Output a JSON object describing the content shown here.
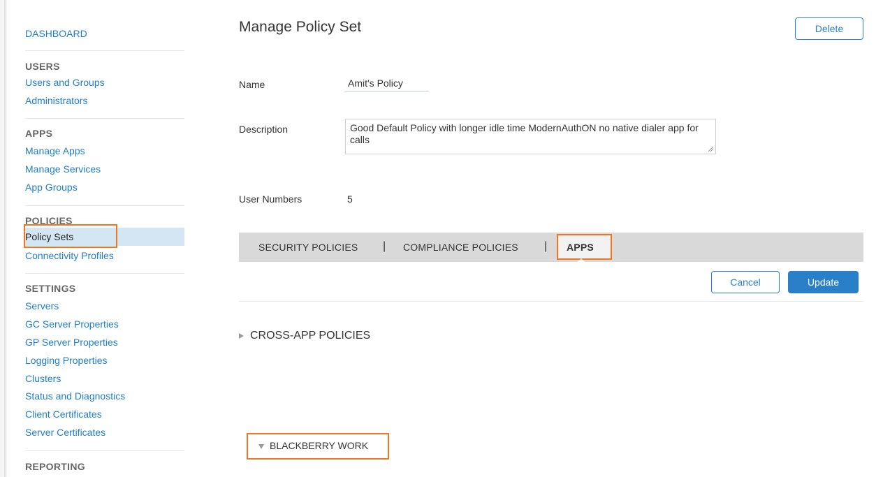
{
  "sidebar": {
    "dashboard": "DASHBOARD",
    "users_heading": "USERS",
    "users_items": [
      "Users and Groups",
      "Administrators"
    ],
    "apps_heading": "APPS",
    "apps_items": [
      "Manage Apps",
      "Manage Services",
      "App Groups"
    ],
    "policies_heading": "POLICIES",
    "policies_items": [
      "Policy Sets",
      "Connectivity Profiles"
    ],
    "settings_heading": "SETTINGS",
    "settings_items": [
      "Servers",
      "GC Server Properties",
      "GP Server Properties",
      "Logging Properties",
      "Clusters",
      "Status and Diagnostics",
      "Client Certificates",
      "Server Certificates"
    ],
    "reporting_heading": "REPORTING",
    "selected": "Policy Sets"
  },
  "page": {
    "title": "Manage Policy Set",
    "delete_label": "Delete"
  },
  "form": {
    "name_label": "Name",
    "name_value": "Amit's Policy",
    "description_label": "Description",
    "description_value": "Good Default Policy with longer idle time ModernAuthON no native dialer app for calls",
    "user_numbers_label": "User Numbers",
    "user_numbers_value": "5"
  },
  "tabs": {
    "items": [
      "SECURITY POLICIES",
      "COMPLIANCE POLICIES",
      "APPS"
    ],
    "separator": "|",
    "active": "APPS"
  },
  "actions": {
    "cancel_label": "Cancel",
    "update_label": "Update"
  },
  "sections": {
    "cross_app": "CROSS-APP POLICIES",
    "blackberry_work": "BLACKBERRY WORK"
  },
  "colors": {
    "link": "#1f7ec8",
    "primary": "#2a80c8",
    "highlight": "#f07722",
    "tabbar": "#d9d9d9",
    "selected_row": "#d4e6f3"
  }
}
